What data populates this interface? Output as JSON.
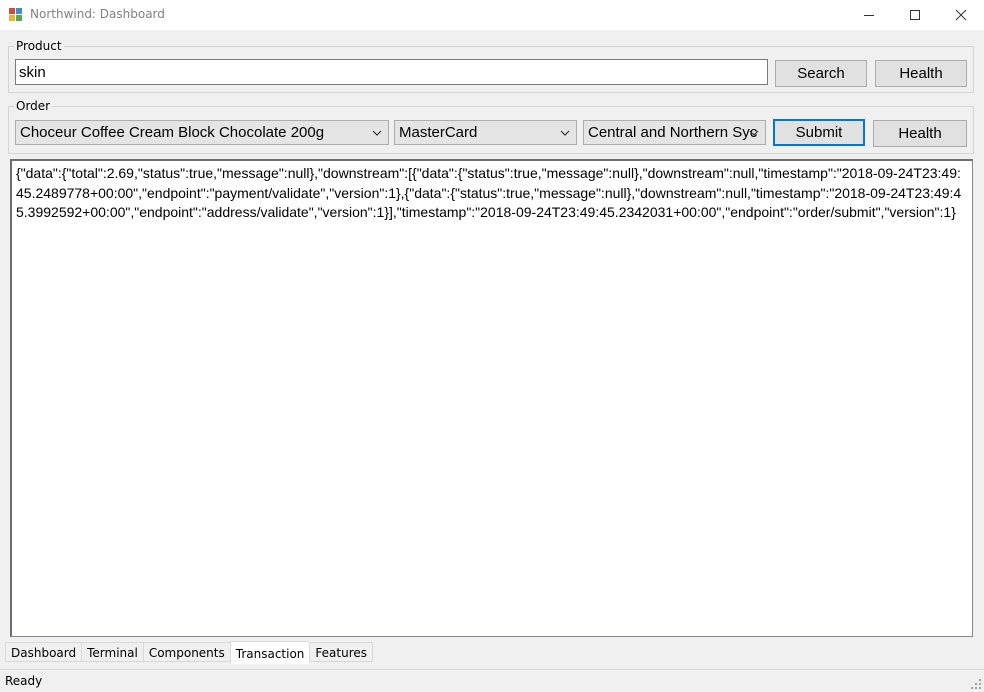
{
  "window": {
    "title": "Northwind: Dashboard",
    "icon": "app-window-icon",
    "controls": [
      "minimize-icon",
      "maximize-icon",
      "close-icon"
    ]
  },
  "product_group": {
    "label": "Product",
    "search_value": "skin",
    "search_label": "Search",
    "health_label": "Health"
  },
  "order_group": {
    "label": "Order",
    "product_selected": "Choceur Coffee Cream Block Chocolate 200g",
    "payment_selected": "MasterCard",
    "address_selected": "Central and Northern Syc",
    "submit_label": "Submit",
    "health_label": "Health"
  },
  "output": {
    "text": "{\"data\":{\"total\":2.69,\"status\":true,\"message\":null},\"downstream\":[{\"data\":{\"status\":true,\"message\":null},\"downstream\":null,\"timestamp\":\"2018-09-24T23:49:45.2489778+00:00\",\"endpoint\":\"payment/validate\",\"version\":1},{\"data\":{\"status\":true,\"message\":null},\"downstream\":null,\"timestamp\":\"2018-09-24T23:49:45.3992592+00:00\",\"endpoint\":\"address/validate\",\"version\":1}],\"timestamp\":\"2018-09-24T23:49:45.2342031+00:00\",\"endpoint\":\"order/submit\",\"version\":1}"
  },
  "tabs": [
    {
      "label": "Dashboard",
      "active": false
    },
    {
      "label": "Terminal",
      "active": false
    },
    {
      "label": "Components",
      "active": false
    },
    {
      "label": "Transaction",
      "active": true
    },
    {
      "label": "Features",
      "active": false
    }
  ],
  "status": {
    "text": "Ready"
  },
  "colors": {
    "accent": "#0078d7",
    "background": "#f0f0f0"
  }
}
